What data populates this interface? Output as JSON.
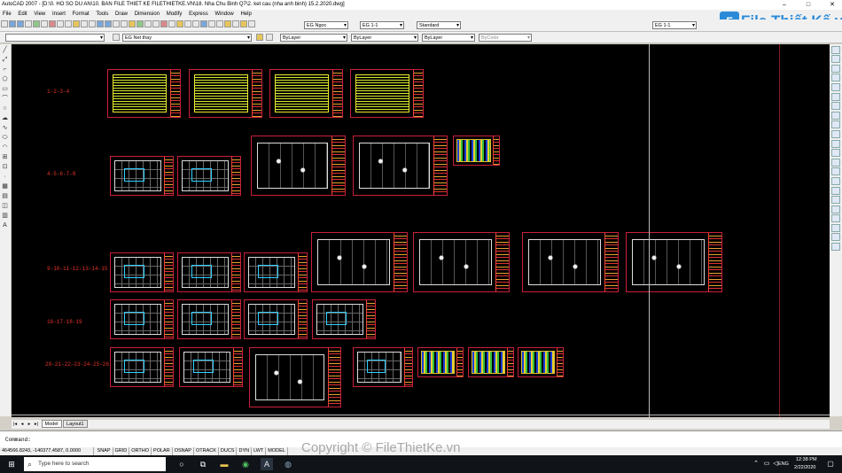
{
  "window": {
    "title": "AutoCAD 2007 - [D:\\0. HO SO DU AN\\10. BAN FILE THIET KE FILETHIETKE.VN\\18. Nha Chu Binh Q7\\2. ket cau (nha anh binh) 15.2.2020.dwg]",
    "minimize": "–",
    "maximize": "□",
    "close": "✕"
  },
  "menu": [
    "File",
    "Edit",
    "View",
    "Insert",
    "Format",
    "Tools",
    "Draw",
    "Dimension",
    "Modify",
    "Express",
    "Window",
    "Help"
  ],
  "toolbar": {
    "textstyle": "EG Ngoc",
    "dimstyle": "EG 1-1",
    "tablestyle": "Standard",
    "plotstyle": "EG 1-1",
    "layer": "EG Net thay",
    "color": "ByLayer",
    "linetype": "ByLayer",
    "lineweight": "ByLayer",
    "plotcolor": "ByColor"
  },
  "logo": {
    "text": "File Thiết Kế.vn",
    "icon": "F"
  },
  "group_labels": [
    "1-2-3-4",
    "4-5-6-7-8",
    "9-10-11-12-13-14-15",
    "16-17-18-19",
    "20-21-22-23-24-25-26"
  ],
  "layout_tabs": {
    "model": "Model",
    "layout1": "Layout1"
  },
  "command": {
    "prompt": "Command:"
  },
  "status": {
    "coords": "464566.8243, -140377.4587, 0.0000",
    "toggles": [
      "SNAP",
      "GRID",
      "ORTHO",
      "POLAR",
      "OSNAP",
      "OTRACK",
      "DUCS",
      "DYN",
      "LWT",
      "MODEL"
    ]
  },
  "watermark": "Copyright © FileThietKe.vn",
  "taskbar": {
    "search_placeholder": "Type here to search",
    "time": "12:38 PM",
    "date": "2/22/2020",
    "lang": "ENG"
  },
  "colors": {
    "canvas": "#000000",
    "sheet_border": "#c8203a",
    "label": "#e8342a",
    "taskbar": "#101418"
  }
}
